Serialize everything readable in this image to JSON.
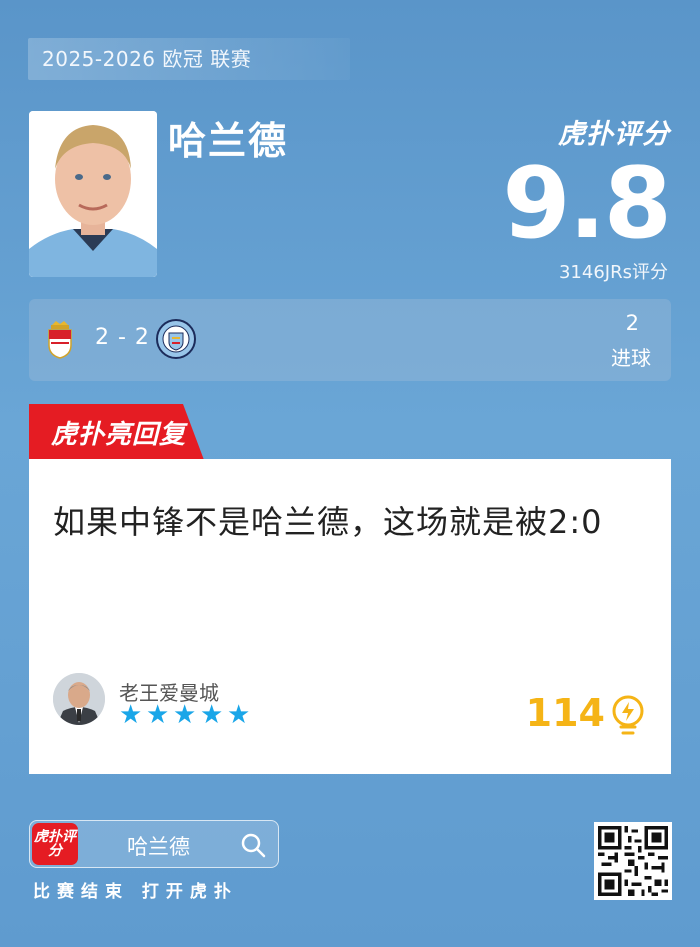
{
  "header": {
    "season": "2025-2026 欧冠 联赛",
    "player_name": "哈兰德",
    "brand_score_label": "虎扑评分",
    "score": "9.8",
    "raters": "3146JRs评分"
  },
  "match": {
    "score": "2 - 2",
    "goals": "2",
    "goals_label": "进球",
    "home_crest": "monaco-crest-icon",
    "away_crest": "man-city-crest-icon"
  },
  "reply": {
    "badge": "虎扑亮回复",
    "text": "如果中锋不是哈兰德，这场就是被2:0",
    "username": "老王爱曼城",
    "stars": 5,
    "likes": "114"
  },
  "footer": {
    "logo_text": "虎扑评分",
    "search_text": "哈兰德",
    "caption": "比赛结束 打开虎扑"
  },
  "colors": {
    "background": "#6aa6d6",
    "badge_red": "#e51c23",
    "like_yellow": "#f5b416",
    "star_blue": "#1aa6e8"
  }
}
